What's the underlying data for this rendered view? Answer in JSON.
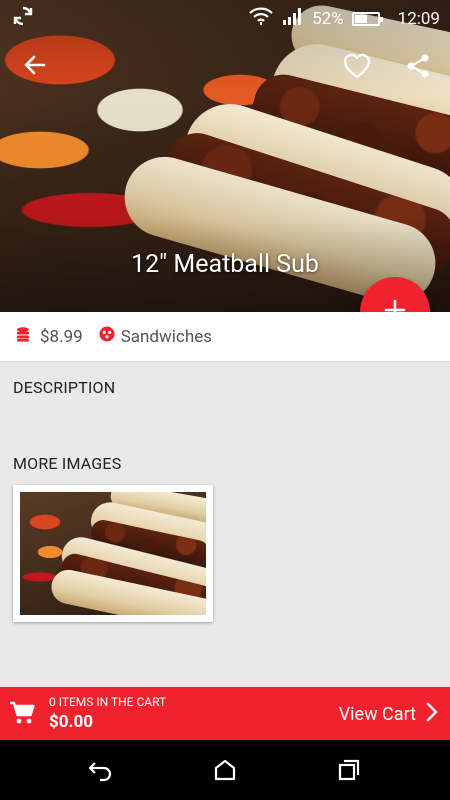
{
  "status_bar": {
    "battery": "52%",
    "time": "12:09",
    "icons": [
      "sync-icon",
      "wifi-icon",
      "signal-icon",
      "battery-icon"
    ]
  },
  "toolbar": {
    "back_icon": "arrow-left-icon",
    "favorite_icon": "heart-outline-icon",
    "share_icon": "share-icon"
  },
  "product": {
    "title": "12\" Meatball Sub",
    "price": "$8.99",
    "category": "Sandwiches"
  },
  "sections": {
    "description_label": "DESCRIPTION",
    "more_images_label": "MORE IMAGES"
  },
  "cart": {
    "count_text": "0 ITEMS IN THE CART",
    "total": "$0.00",
    "view_label": "View Cart"
  },
  "colors": {
    "accent": "#f0222e",
    "background": "#e9e9e9"
  }
}
